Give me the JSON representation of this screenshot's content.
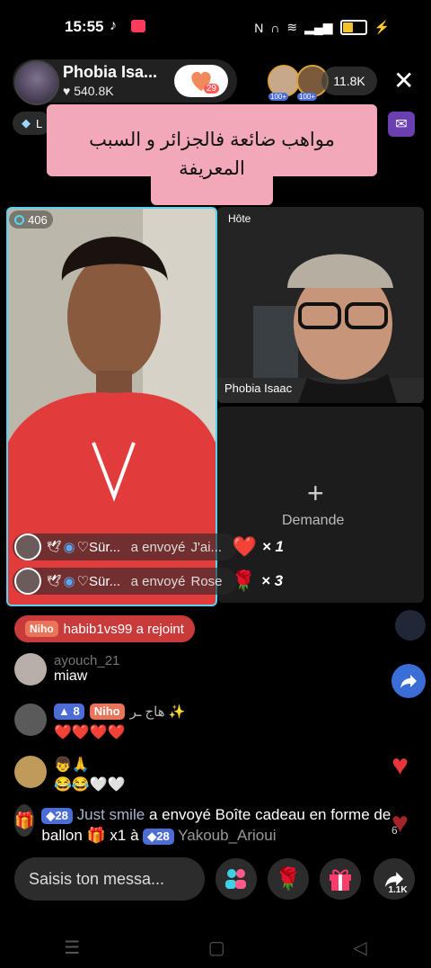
{
  "status": {
    "time": "15:55"
  },
  "host": {
    "name": "Phobia Isa...",
    "likes": "540.8K",
    "heart_badge": "29"
  },
  "viewers": {
    "badge_a": "100+",
    "badge_b": "100+",
    "count": "11.8K"
  },
  "pill": {
    "text": "L"
  },
  "banner": {
    "text": "مواهب ضائعة فالجزائر و السبب المعريفة"
  },
  "left_tile": {
    "count": "406"
  },
  "right_tile": {
    "hote_label": "Hôte",
    "host_label": "Phobia Isaac"
  },
  "request": {
    "label": "Demande"
  },
  "gifts": [
    {
      "user": "♡Sür...",
      "action": "a envoyé",
      "item": "J'ai...",
      "qty": "× 1"
    },
    {
      "user": "♡Sür...",
      "action": "a envoyé",
      "item": "Rose",
      "qty": "× 3"
    }
  ],
  "join": {
    "tag": "Niho",
    "text": "habib1vs99 a rejoint"
  },
  "chat": [
    {
      "user": "ayouch_21",
      "message": "miaw"
    },
    {
      "level": "8",
      "tag": "Niho",
      "user": "هاج ـر ✨",
      "message": "❤️❤️❤️❤️"
    },
    {
      "message1": "👦🙏",
      "message2": "😂😂🤍🤍"
    },
    {
      "level": "28",
      "user": "Just smile",
      "action": "a envoyé Boîte cadeau en forme de ballon 🎁 x1 à",
      "level2": "28",
      "target": "Yakoub_Arioui"
    }
  ],
  "input": {
    "placeholder": "Saisis ton messa..."
  },
  "share": {
    "count": "1.1K"
  },
  "side_count": "6",
  "colors": {
    "accent_blue": "#58d4f2",
    "banner_pink": "#f2a8b8",
    "join_red": "#c93b3b",
    "level_blue": "#4d6dd6",
    "heart_red": "#e8353b"
  }
}
